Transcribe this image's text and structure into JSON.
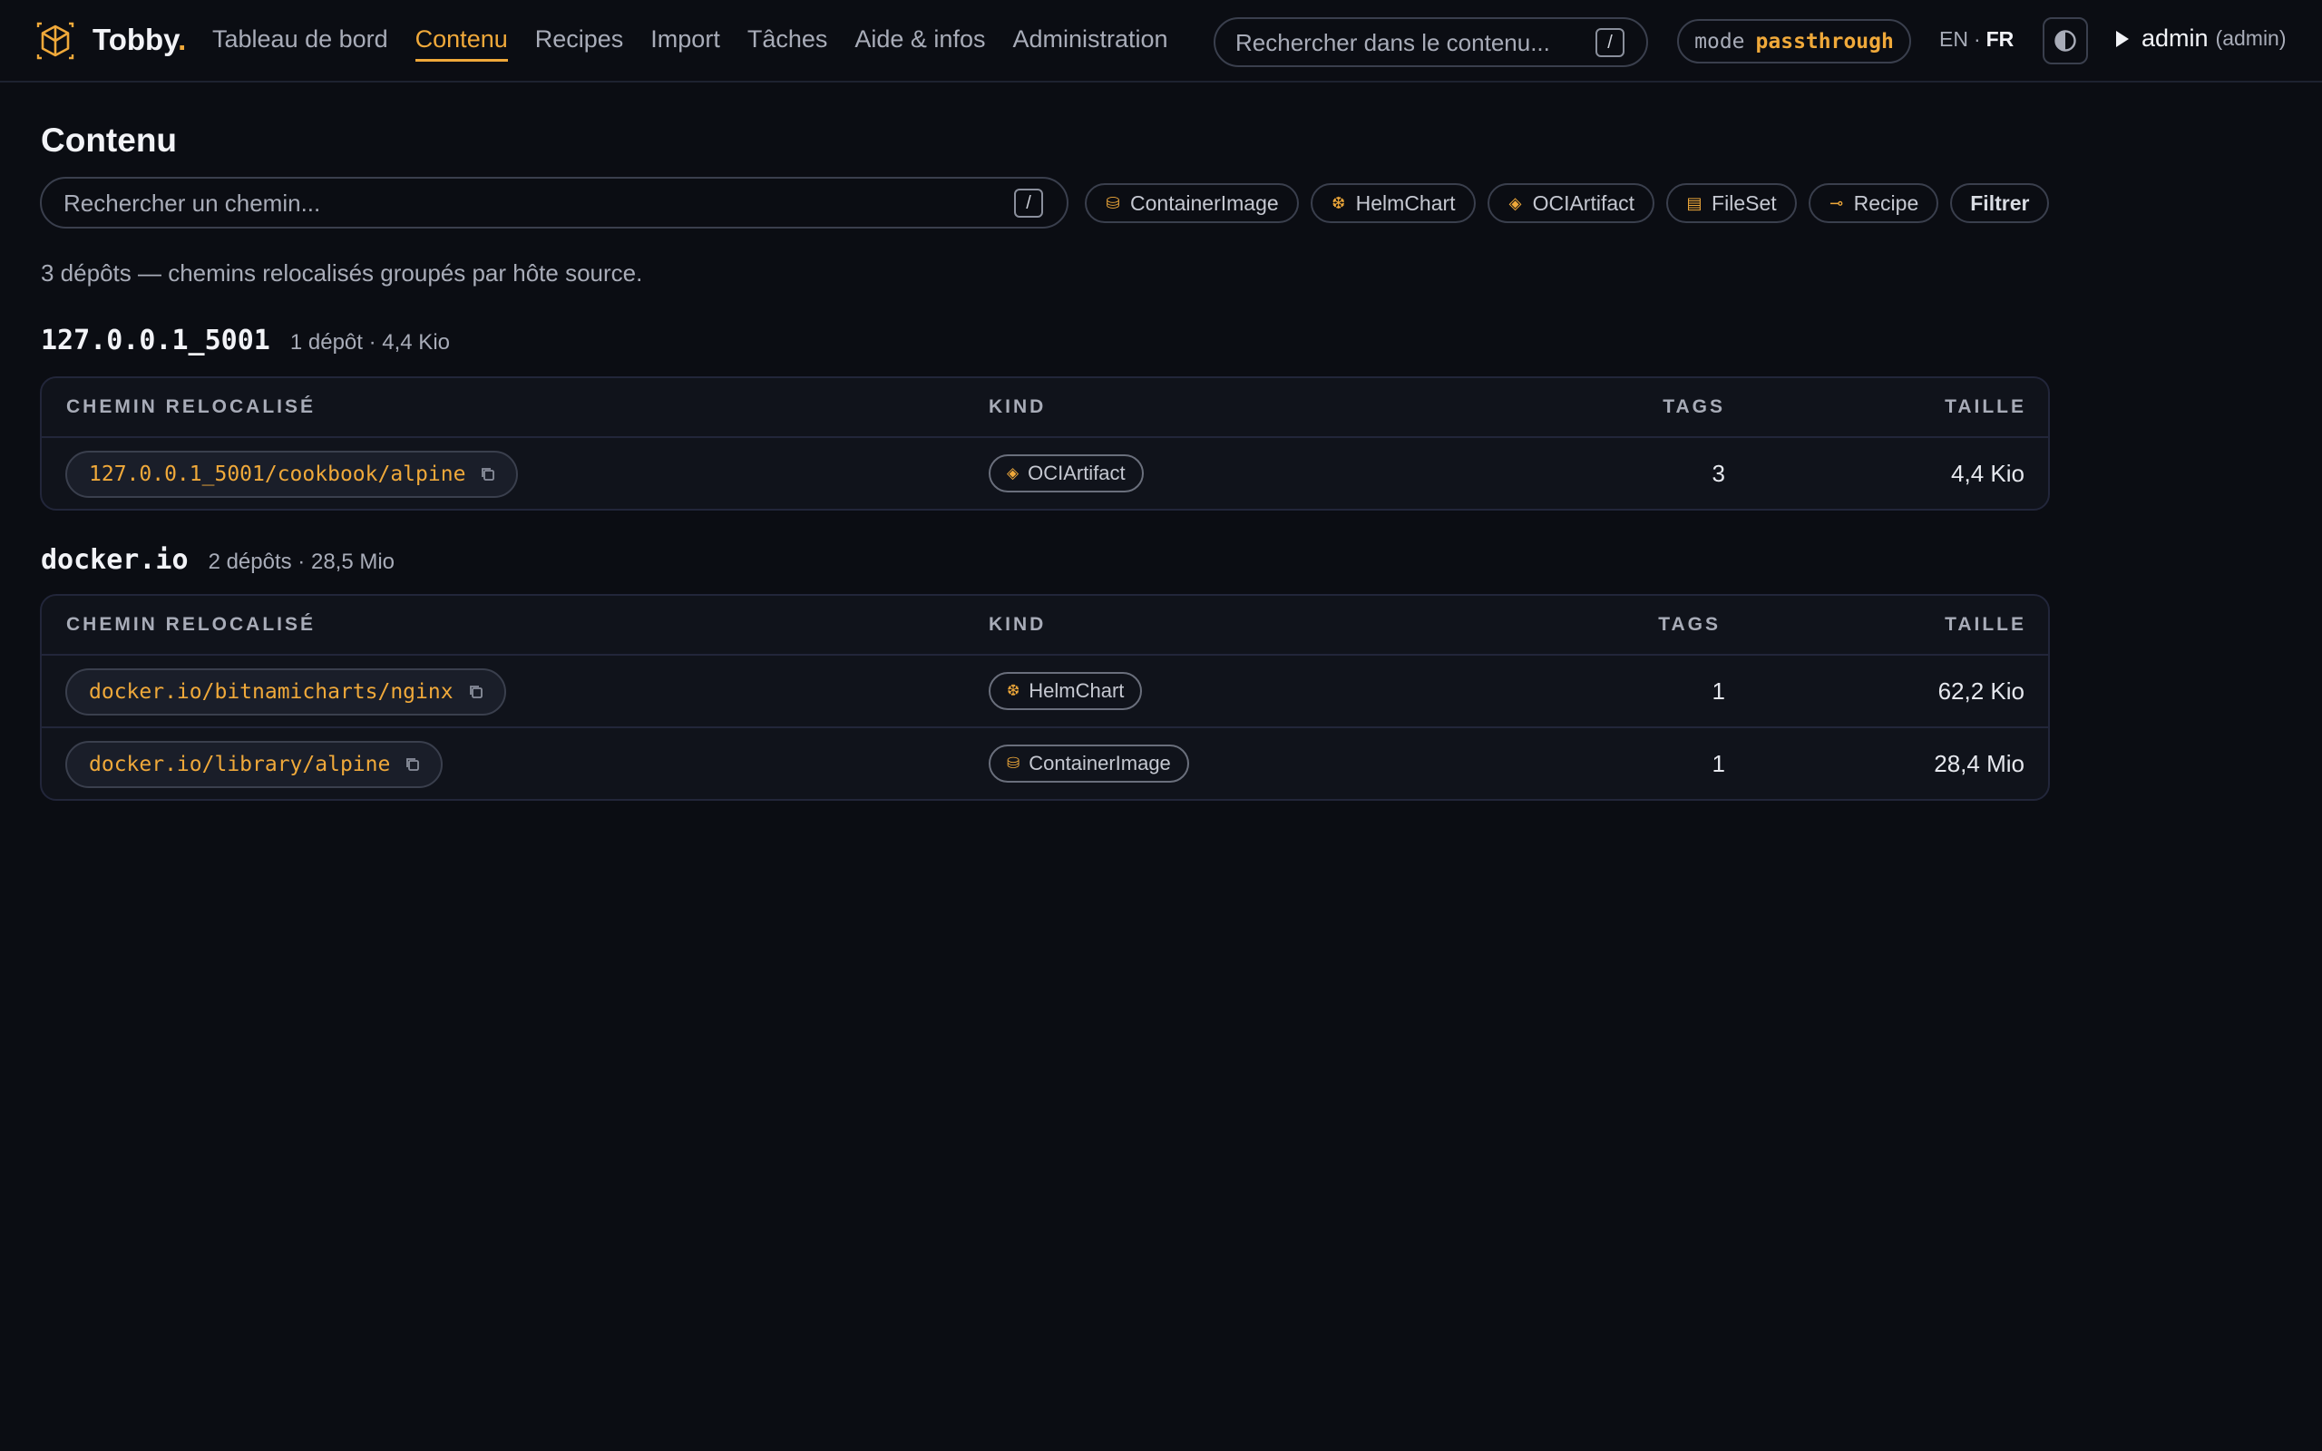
{
  "header": {
    "brand": "Tobby",
    "brand_dot": ".",
    "nav": [
      {
        "label": "Tableau de bord",
        "active": false
      },
      {
        "label": "Contenu",
        "active": true
      },
      {
        "label": "Recipes",
        "active": false
      },
      {
        "label": "Import",
        "active": false
      },
      {
        "label": "Tâches",
        "active": false
      },
      {
        "label": "Aide & infos",
        "active": false
      },
      {
        "label": "Administration",
        "active": false
      }
    ],
    "search_placeholder": "Rechercher dans le contenu...",
    "search_shortcut": "/",
    "mode_label": "mode",
    "mode_value": "passthrough",
    "lang_en": "EN",
    "lang_sep": "·",
    "lang_fr": "FR",
    "user_name": "admin",
    "user_role": "(admin)"
  },
  "main": {
    "title": "Contenu",
    "path_search_placeholder": "Rechercher un chemin...",
    "path_search_shortcut": "/",
    "kind_chips": [
      {
        "icon": "container-image-icon",
        "label": "ContainerImage",
        "glyph": "⛁"
      },
      {
        "icon": "helm-chart-icon",
        "label": "HelmChart",
        "glyph": "❆"
      },
      {
        "icon": "oci-artifact-icon",
        "label": "OCIArtifact",
        "glyph": "◈"
      },
      {
        "icon": "file-set-icon",
        "label": "FileSet",
        "glyph": "▤"
      },
      {
        "icon": "recipe-icon",
        "label": "Recipe",
        "glyph": "⊸"
      }
    ],
    "filter_button": "Filtrer",
    "summary": "3 dépôts — chemins relocalisés groupés par hôte source.",
    "columns": {
      "path": "CHEMIN RELOCALISÉ",
      "kind": "KIND",
      "tags": "TAGS",
      "size": "TAILLE"
    },
    "groups": [
      {
        "host": "127.0.0.1_5001",
        "meta": "1 dépôt · 4,4 Kio",
        "rows": [
          {
            "path": "127.0.0.1_5001/cookbook/alpine",
            "kind": "OCIArtifact",
            "kind_glyph": "◈",
            "kind_icon": "oci-artifact-icon",
            "tags": "3",
            "size": "4,4 Kio"
          }
        ]
      },
      {
        "host": "docker.io",
        "meta": "2 dépôts · 28,5 Mio",
        "rows": [
          {
            "path": "docker.io/bitnamicharts/nginx",
            "kind": "HelmChart",
            "kind_glyph": "❆",
            "kind_icon": "helm-chart-icon",
            "tags": "1",
            "size": "62,2 Kio"
          },
          {
            "path": "docker.io/library/alpine",
            "kind": "ContainerImage",
            "kind_glyph": "⛁",
            "kind_icon": "container-image-icon",
            "tags": "1",
            "size": "28,4 Mio"
          }
        ]
      }
    ]
  },
  "colors": {
    "background": "#0b0d13",
    "accent": "#f0a93a",
    "text": "#e6e8ee",
    "muted": "#a8acb8"
  }
}
